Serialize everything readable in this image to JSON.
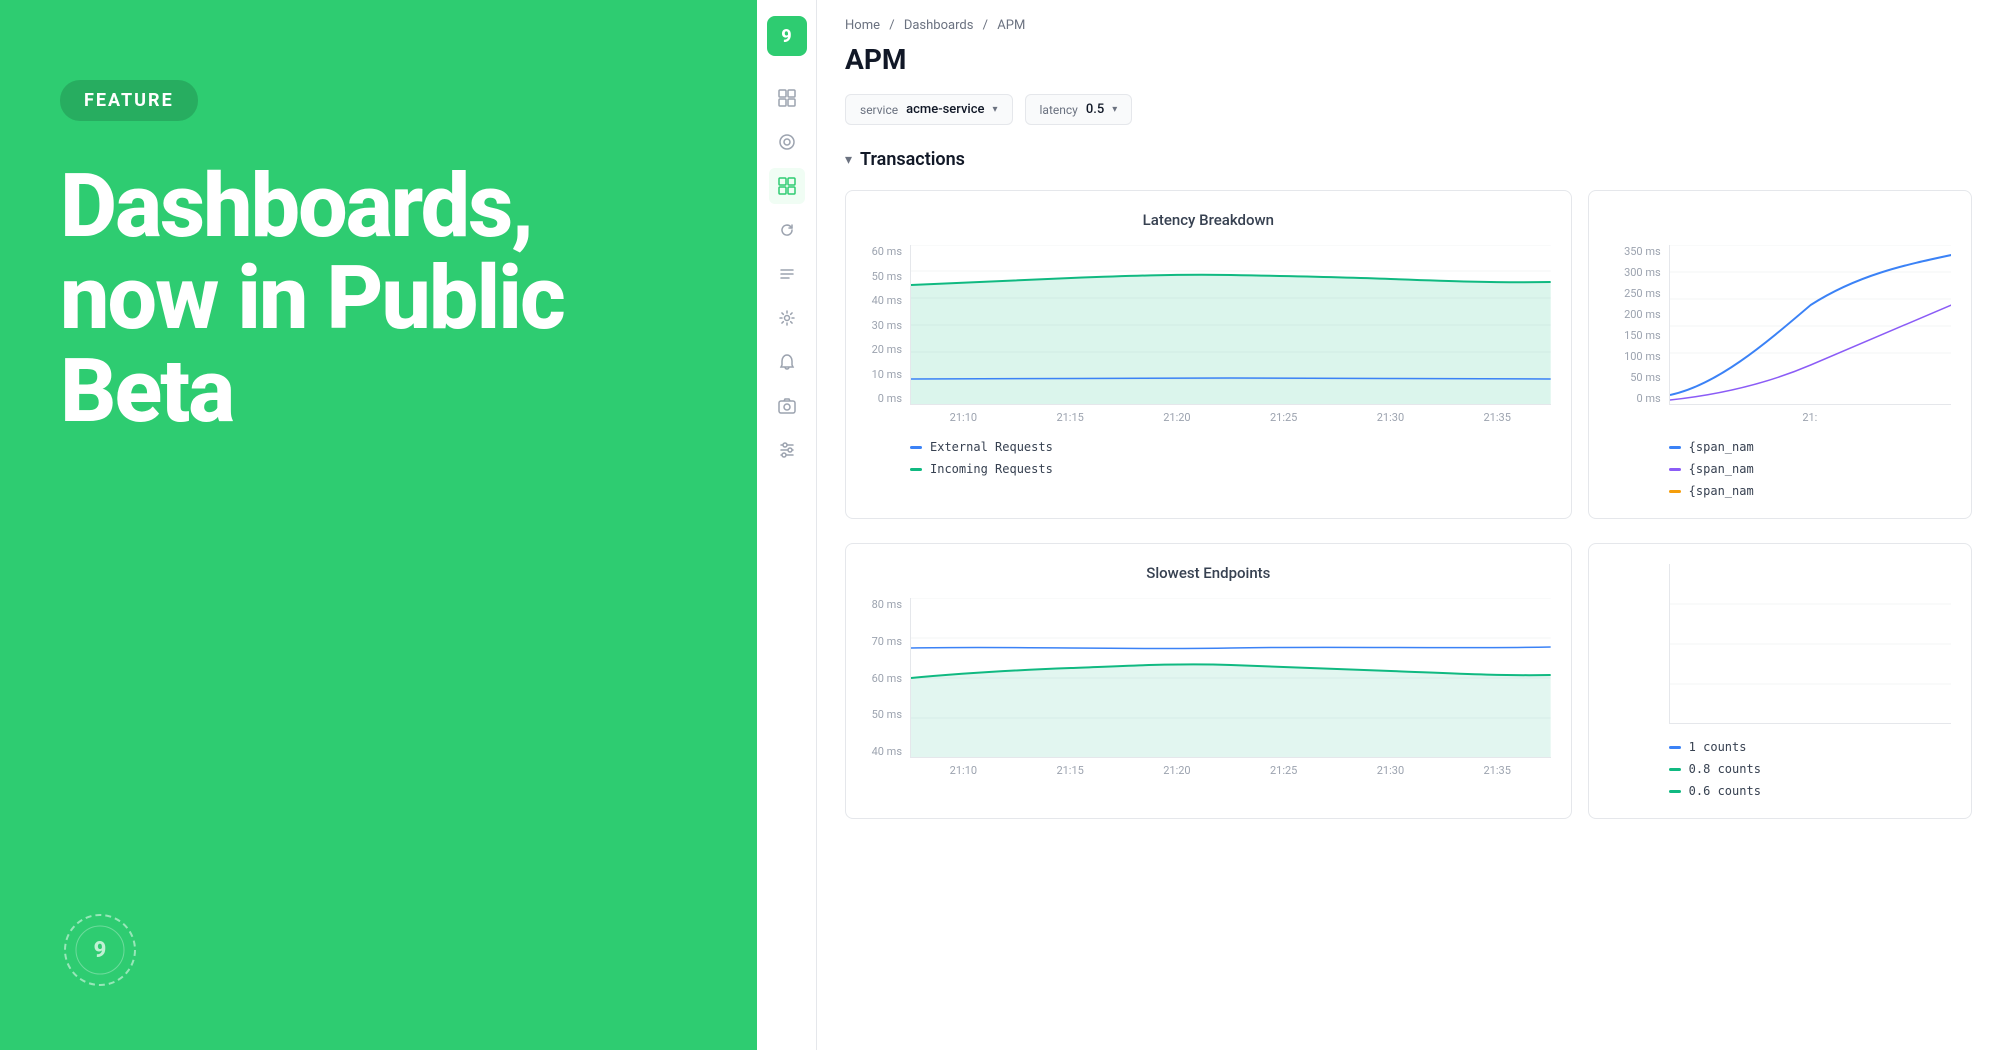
{
  "left": {
    "badge": "FEATURE",
    "title_line1": "Dashboards,",
    "title_line2": "now in Public",
    "title_line3": "Beta"
  },
  "breadcrumb": {
    "home": "Home",
    "sep1": "/",
    "dashboards": "Dashboards",
    "sep2": "/",
    "current": "APM"
  },
  "page": {
    "title": "APM"
  },
  "filters": [
    {
      "label": "service",
      "value": "acme-service"
    },
    {
      "label": "latency",
      "value": "0.5"
    }
  ],
  "section": {
    "label": "Transactions"
  },
  "chart1": {
    "title": "Latency Breakdown",
    "y_labels": [
      "60 ms",
      "50 ms",
      "40 ms",
      "30 ms",
      "20 ms",
      "10 ms",
      "0 ms"
    ],
    "x_labels": [
      "21:10",
      "21:15",
      "21:20",
      "21:25",
      "21:30",
      "21:35"
    ],
    "legend": [
      {
        "label": "External Requests",
        "color": "#3b82f6"
      },
      {
        "label": "Incoming Requests",
        "color": "#10b981"
      }
    ]
  },
  "chart1_right": {
    "y_labels": [
      "350 ms",
      "300 ms",
      "250 ms",
      "200 ms",
      "150 ms",
      "100 ms",
      "50 ms",
      "0 ms"
    ],
    "x_labels": [
      "21:"
    ],
    "legend": [
      {
        "label": "{span_nam",
        "color": "#3b82f6"
      },
      {
        "label": "{span_nam",
        "color": "#8b5cf6"
      },
      {
        "label": "{span_nam",
        "color": "#f59e0b"
      }
    ]
  },
  "chart2": {
    "title": "Slowest Endpoints",
    "y_labels": [
      "80 ms",
      "70 ms",
      "60 ms",
      "50 ms",
      "40 ms"
    ],
    "x_labels": [
      "21:10",
      "21:15",
      "21:20",
      "21:25",
      "21:30",
      "21:35"
    ],
    "legend_right": [
      {
        "label": "1 counts",
        "color": "#3b82f6"
      },
      {
        "label": "0.8 counts",
        "color": "#10b981"
      },
      {
        "label": "0.6 counts",
        "color": "#10b981"
      }
    ]
  },
  "sidebar": {
    "logo_text": "9",
    "nav_items": [
      {
        "icon": "⊞",
        "name": "dashboard",
        "active": false
      },
      {
        "icon": "◎",
        "name": "monitor",
        "active": false
      },
      {
        "icon": "⊟",
        "name": "apm",
        "active": true
      },
      {
        "icon": "↺",
        "name": "logs",
        "active": false
      },
      {
        "icon": "≡",
        "name": "traces",
        "active": false
      },
      {
        "icon": "⚙",
        "name": "settings",
        "active": false
      },
      {
        "icon": "((•))",
        "name": "alerts",
        "active": false
      },
      {
        "icon": "▷",
        "name": "synthetics",
        "active": false
      },
      {
        "icon": "≈",
        "name": "controls",
        "active": false
      }
    ]
  }
}
